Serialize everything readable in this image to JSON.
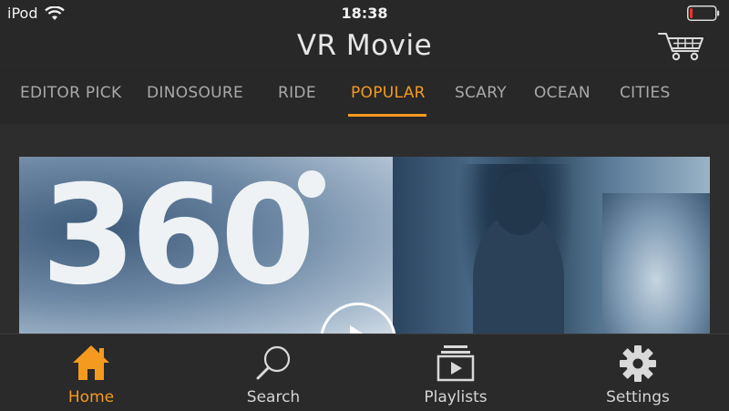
{
  "status_bar": {
    "carrier": "iPod",
    "time": "18:38",
    "icons": [
      "wifi-icon",
      "battery-icon"
    ],
    "battery_level": 0.12,
    "battery_color": "#e8332c"
  },
  "header": {
    "title": "VR Movie",
    "cart_icon": "cart-icon"
  },
  "tabs": [
    {
      "label": "EDITOR PICK",
      "active": false
    },
    {
      "label": "DINOSOURE",
      "active": false
    },
    {
      "label": "RIDE",
      "active": false
    },
    {
      "label": "POPULAR",
      "active": true
    },
    {
      "label": "SCARY",
      "active": false
    },
    {
      "label": "OCEAN",
      "active": false
    },
    {
      "label": "CITIES",
      "active": false
    }
  ],
  "featured": {
    "badge": "360",
    "play_icon": "play-icon"
  },
  "bottom_nav": [
    {
      "label": "Home",
      "icon": "home-icon",
      "active": true
    },
    {
      "label": "Search",
      "icon": "search-icon",
      "active": false
    },
    {
      "label": "Playlists",
      "icon": "playlist-icon",
      "active": false
    },
    {
      "label": "Settings",
      "icon": "gear-icon",
      "active": false
    }
  ],
  "colors": {
    "accent": "#f49a1f",
    "background": "#2b2b2b",
    "inactive_text": "#a9a9a9"
  }
}
